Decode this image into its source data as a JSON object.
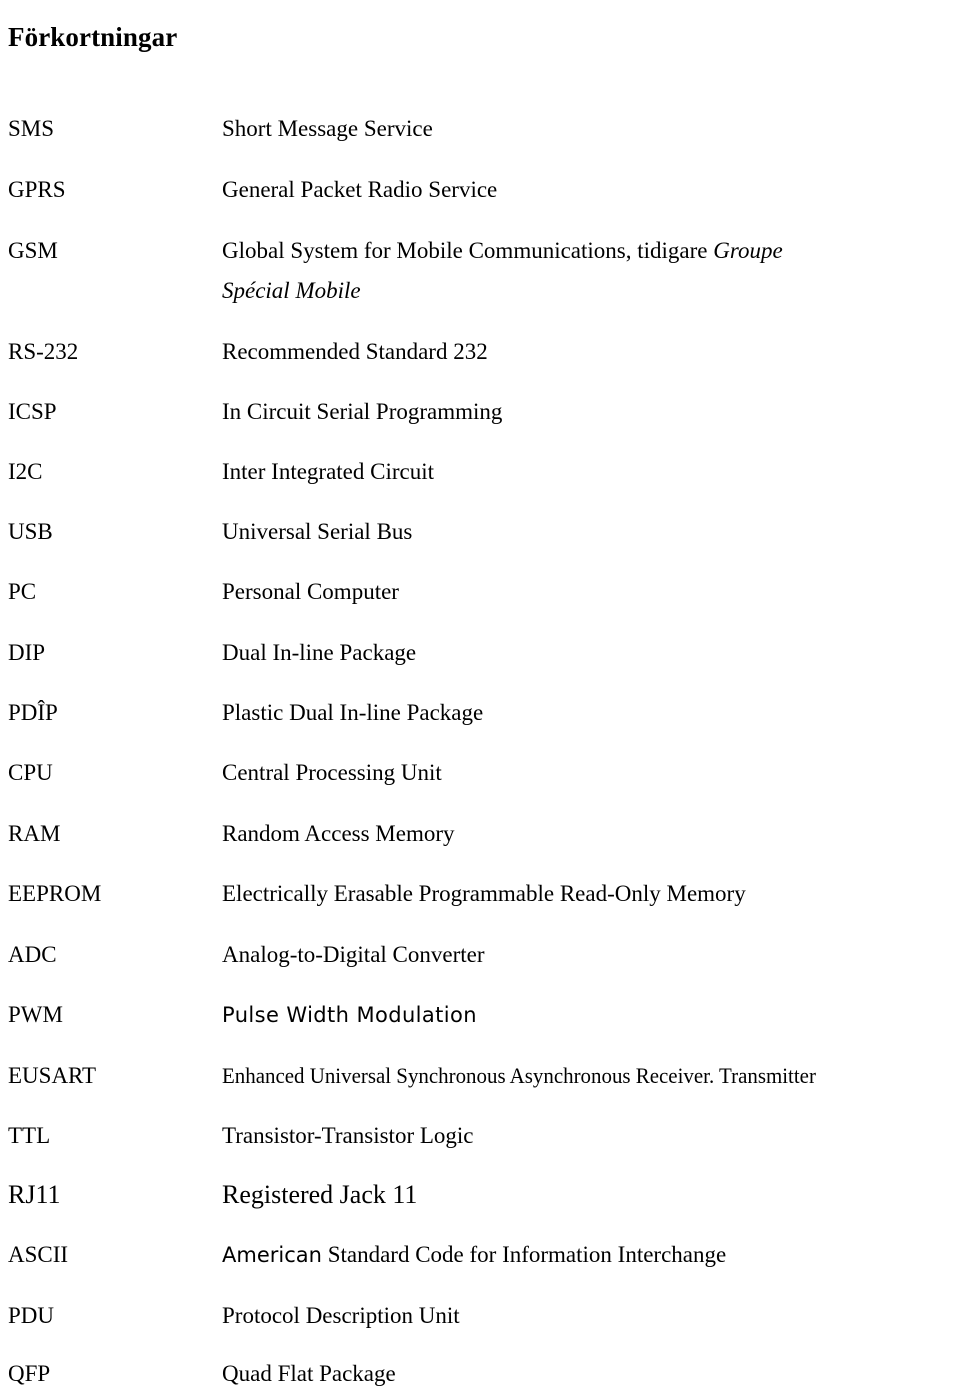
{
  "document": {
    "title": "Förkortningar",
    "language": "sv"
  },
  "glossary": {
    "entries": [
      {
        "term": "SMS",
        "definition": "Short Message Service"
      },
      {
        "term": "GPRS",
        "definition": "General Packet Radio Service"
      },
      {
        "term": "GSM",
        "definition": "Global System for Mobile Communications, tidigare ",
        "definition_italic": "Groupe",
        "definition_line2": "Spécial Mobile"
      },
      {
        "term": "RS-232",
        "definition": "Recommended Standard 232"
      },
      {
        "term": "ICSP",
        "definition": "In Circuit Serial Programming"
      },
      {
        "term": "I2C",
        "definition": "Inter Integrated Circuit"
      },
      {
        "term": "USB",
        "definition": "Universal Serial Bus"
      },
      {
        "term": "PC",
        "definition": "Personal Computer"
      },
      {
        "term": "DIP",
        "definition": "Dual In-line Package"
      },
      {
        "term": "PDÎP",
        "definition": "Plastic Dual In-line Package"
      },
      {
        "term": "CPU",
        "definition": "Central Processing Unit"
      },
      {
        "term": "RAM",
        "definition": "Random Access Memory"
      },
      {
        "term": "EEPROM",
        "definition": "Electrically Erasable Programmable Read-Only Memory"
      },
      {
        "term": "ADC",
        "definition": "Analog-to-Digital Converter"
      },
      {
        "term": "PWM",
        "definition": "Pulse Width Modulation"
      },
      {
        "term": "EUSART",
        "definition": "Enhanced Universal Synchronous Asynchronous Receiver. Transmitter"
      },
      {
        "term": "TTL",
        "definition": "Transistor-Transistor Logic"
      },
      {
        "term": "RJ11",
        "definition": "Registered Jack 11"
      },
      {
        "term": "ASCII",
        "definition_first_word": "American",
        "definition_rest": " Standard Code for Information Interchange"
      },
      {
        "term": "PDU",
        "definition": "Protocol Description Unit"
      },
      {
        "term": "QFP",
        "definition": "Quad Flat Package"
      }
    ]
  },
  "colors": {
    "page_background": "#ffffff",
    "text": "#000000"
  }
}
